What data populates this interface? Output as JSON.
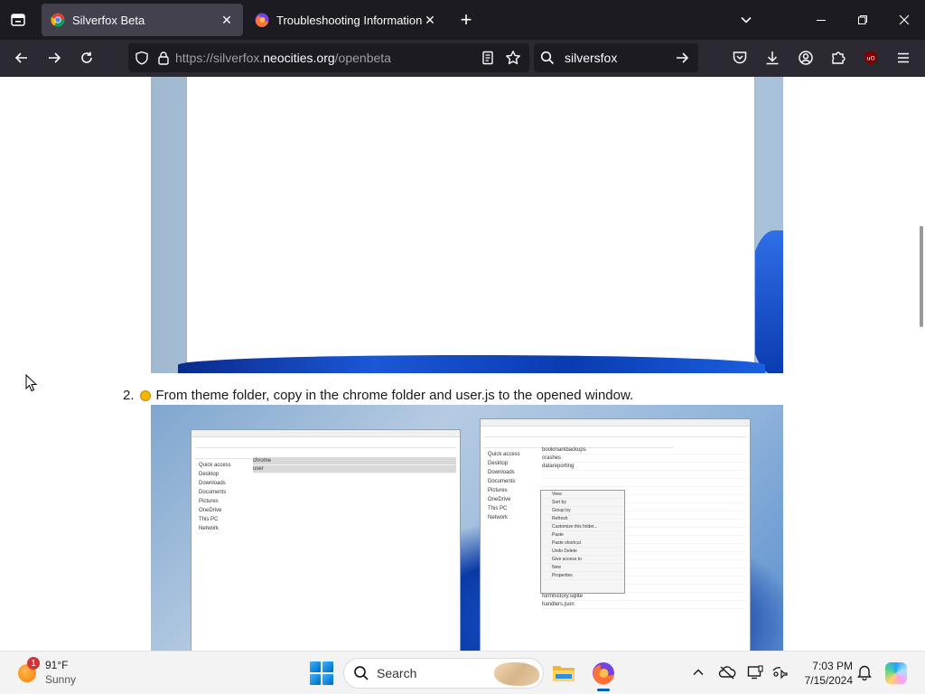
{
  "browser": {
    "tabs": [
      {
        "title": "Silverfox Beta",
        "active": true
      },
      {
        "title": "Troubleshooting Information",
        "active": false
      }
    ],
    "url": {
      "prefix": "https://silverfox.",
      "host": "neocities.org",
      "path": "/openbeta"
    },
    "search": {
      "value": "silversfox"
    }
  },
  "content": {
    "step_number": "2.",
    "step_text": "From theme folder, copy in the chrome folder and user.js to the opened window.",
    "explorer_left": {
      "sidebar": [
        "Quick access",
        "Desktop",
        "Downloads",
        "Documents",
        "Pictures",
        "OneDrive",
        "This PC",
        "Network"
      ],
      "rows": [
        "chrome",
        "user"
      ]
    },
    "explorer_right": {
      "sidebar": [
        "Quick access",
        "Desktop",
        "Downloads",
        "Documents",
        "Pictures",
        "OneDrive",
        "This PC",
        "Network"
      ],
      "rows": [
        "bookmarkbackups",
        "crashes",
        "datareporting",
        "",
        "",
        "",
        "",
        "",
        "",
        "",
        "",
        "",
        "",
        "",
        "",
        "",
        "extensions.json",
        "favicons.sqlite",
        "formhistory.sqlite",
        "handlers.json"
      ],
      "context_menu": [
        "View",
        "Sort by",
        "Group by",
        "Refresh",
        "Customize this folder...",
        "Paste",
        "Paste shortcut",
        "Undo Delete",
        "Give access to",
        "New",
        "Properties"
      ]
    }
  },
  "taskbar": {
    "weather": {
      "badge": "1",
      "temp": "91°F",
      "condition": "Sunny"
    },
    "search_label": "Search",
    "time": "7:03 PM",
    "date": "7/15/2024"
  },
  "colors": {
    "tab_bg": "#1c1b22",
    "nav_bg": "#2b2a33",
    "active_tab": "#42414d",
    "accent": "#005fb8"
  }
}
